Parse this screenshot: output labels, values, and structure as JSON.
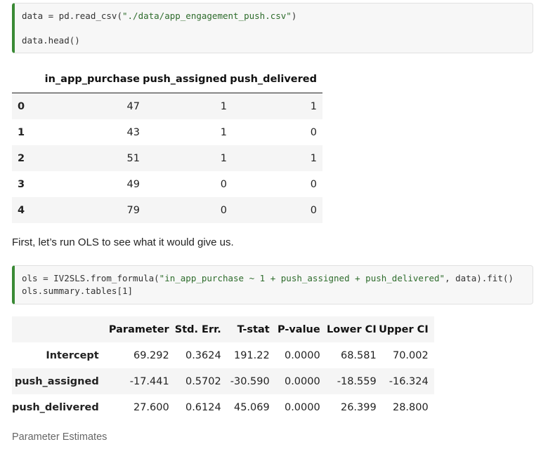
{
  "cell1": {
    "line1_prefix": "data = pd.read_csv(",
    "line1_string": "\"./data/app_engagement_push.csv\"",
    "line1_suffix": ")",
    "line2": "data.head()"
  },
  "df": {
    "columns": [
      "in_app_purchase",
      "push_assigned",
      "push_delivered"
    ],
    "rows": [
      {
        "index": "0",
        "values": [
          "47",
          "1",
          "1"
        ]
      },
      {
        "index": "1",
        "values": [
          "43",
          "1",
          "0"
        ]
      },
      {
        "index": "2",
        "values": [
          "51",
          "1",
          "1"
        ]
      },
      {
        "index": "3",
        "values": [
          "49",
          "0",
          "0"
        ]
      },
      {
        "index": "4",
        "values": [
          "79",
          "0",
          "0"
        ]
      }
    ]
  },
  "prose": "First, let’s run OLS to see what it would give us.",
  "cell2": {
    "line1_prefix": "ols = IV2SLS.from_formula(",
    "line1_string": "\"in_app_purchase ~ 1 + push_assigned + push_delivered\"",
    "line1_suffix": ", data).fit()",
    "line2": "ols.summary.tables[1]"
  },
  "ols": {
    "columns": [
      "Parameter",
      "Std. Err.",
      "T-stat",
      "P-value",
      "Lower CI",
      "Upper CI"
    ],
    "rows": [
      {
        "name": "Intercept",
        "values": [
          "69.292",
          "0.3624",
          "191.22",
          "0.0000",
          "68.581",
          "70.002"
        ]
      },
      {
        "name": "push_assigned",
        "values": [
          "-17.441",
          "0.5702",
          "-30.590",
          "0.0000",
          "-18.559",
          "-16.324"
        ]
      },
      {
        "name": "push_delivered",
        "values": [
          "27.600",
          "0.6124",
          "45.069",
          "0.0000",
          "26.399",
          "28.800"
        ]
      }
    ]
  },
  "caption": "Parameter Estimates"
}
